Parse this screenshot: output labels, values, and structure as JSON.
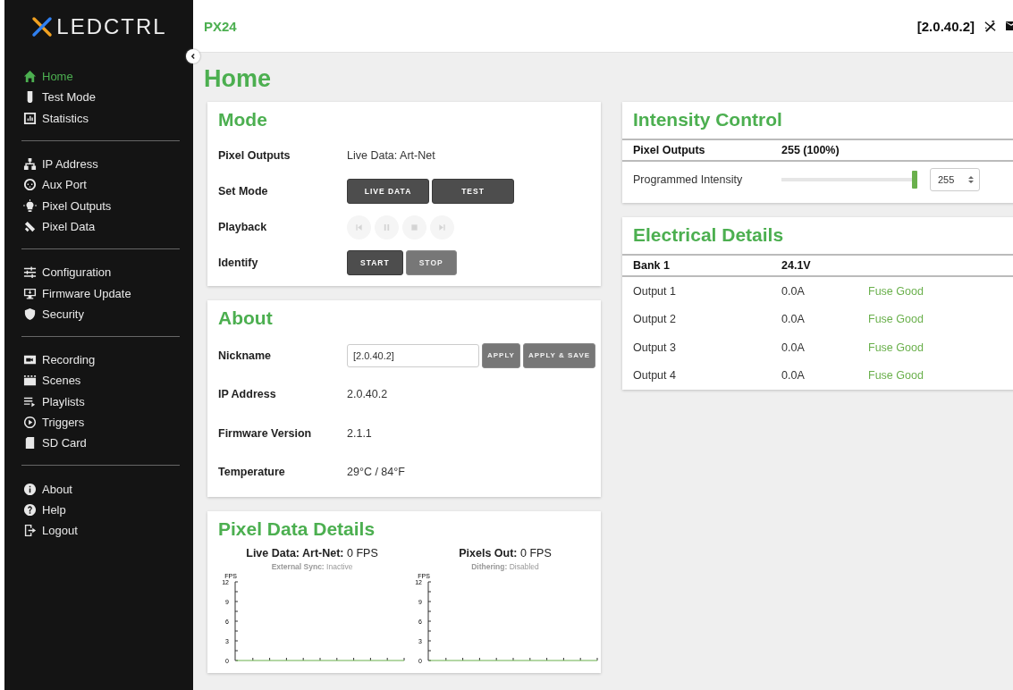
{
  "sidebar": {
    "logo_text": "LEDCTRL",
    "groups": [
      [
        {
          "label": "Home",
          "selected": true
        },
        {
          "label": "Test Mode",
          "selected": false
        },
        {
          "label": "Statistics",
          "selected": false
        }
      ],
      [
        {
          "label": "IP Address",
          "selected": false
        },
        {
          "label": "Aux Port",
          "selected": false
        },
        {
          "label": "Pixel Outputs",
          "selected": false
        },
        {
          "label": "Pixel Data",
          "selected": false
        }
      ],
      [
        {
          "label": "Configuration",
          "selected": false
        },
        {
          "label": "Firmware Update",
          "selected": false
        },
        {
          "label": "Security",
          "selected": false
        }
      ],
      [
        {
          "label": "Recording",
          "selected": false
        },
        {
          "label": "Scenes",
          "selected": false
        },
        {
          "label": "Playlists",
          "selected": false
        },
        {
          "label": "Triggers",
          "selected": false
        },
        {
          "label": "SD Card",
          "selected": false
        }
      ],
      [
        {
          "label": "About",
          "selected": false
        },
        {
          "label": "Help",
          "selected": false
        },
        {
          "label": "Logout",
          "selected": false
        }
      ]
    ]
  },
  "topbar": {
    "device": "PX24",
    "address": "[2.0.40.2]"
  },
  "page_title": "Home",
  "mode": {
    "title": "Mode",
    "rows": [
      {
        "kind": "text",
        "label": "Pixel Outputs",
        "value": "Live Data: Art-Net"
      },
      {
        "kind": "buttons",
        "label": "Set Mode",
        "buttons": [
          {
            "label": "LIVE DATA",
            "disabled": false
          },
          {
            "label": "TEST",
            "disabled": false
          }
        ]
      },
      {
        "kind": "playback",
        "label": "Playback",
        "disabled": true
      },
      {
        "kind": "buttons",
        "label": "Identify",
        "buttons": [
          {
            "label": "START",
            "disabled": false
          },
          {
            "label": "STOP",
            "disabled": true
          }
        ]
      }
    ]
  },
  "about": {
    "title": "About",
    "nickname_label": "Nickname",
    "nickname": "[2.0.40.2]",
    "buttons": [
      {
        "label": "APPLY",
        "disabled": true
      },
      {
        "label": "APPLY & SAVE",
        "disabled": true
      }
    ],
    "rows": [
      {
        "label": "IP Address",
        "value": "2.0.40.2"
      },
      {
        "label": "Firmware Version",
        "value": "2.1.1"
      },
      {
        "label": "Temperature",
        "value": "29°C / 84°F"
      }
    ]
  },
  "pixel_data": {
    "title": "Pixel Data Details",
    "panels": [
      {
        "heading": "**Live Data: Art-Net:** 0 FPS",
        "sub": "**External Sync:** Inactive",
        "chart_data": {
          "type": "line",
          "ylabel": "FPS",
          "ylim": [
            0,
            12
          ],
          "yticks": [
            0,
            3,
            6,
            9,
            12
          ],
          "categories": [
            null,
            null,
            null,
            null,
            null,
            null,
            null,
            null,
            null,
            null,
            null
          ],
          "series": [
            {
              "color": "#6ab04c",
              "values": [
                0,
                0,
                0,
                0,
                0,
                0,
                0,
                0,
                0,
                0,
                0
              ]
            }
          ]
        }
      },
      {
        "heading": "**Pixels Out:** 0 FPS",
        "sub": "**Dithering:** Disabled",
        "chart_data": {
          "type": "line",
          "ylabel": "FPS",
          "ylim": [
            0,
            12
          ],
          "yticks": [
            0,
            3,
            6,
            9,
            12
          ],
          "categories": [
            null,
            null,
            null,
            null,
            null,
            null,
            null,
            null,
            null,
            null,
            null
          ],
          "series": [
            {
              "color": "#6ab04c",
              "values": [
                0,
                0,
                0,
                0,
                0,
                0,
                0,
                0,
                0,
                0,
                0
              ]
            }
          ]
        }
      }
    ]
  },
  "intensity": {
    "title": "Intensity Control",
    "header": [
      "Pixel Outputs",
      "255 (100%)"
    ],
    "label": "Programmed Intensity",
    "level": 1,
    "value": "255"
  },
  "electrical": {
    "title": "Electrical Details",
    "header": [
      "Bank 1",
      "24.1V"
    ],
    "rows": [
      {
        "output": "Output 1",
        "current": "0.0A",
        "status": "Fuse Good",
        "fuse_ok": true
      },
      {
        "output": "Output 2",
        "current": "0.0A",
        "status": "Fuse Good",
        "fuse_ok": true
      },
      {
        "output": "Output 3",
        "current": "0.0A",
        "status": "Fuse Good",
        "fuse_ok": true
      },
      {
        "output": "Output 4",
        "current": "0.0A",
        "status": "Fuse Good",
        "fuse_ok": true
      }
    ]
  }
}
